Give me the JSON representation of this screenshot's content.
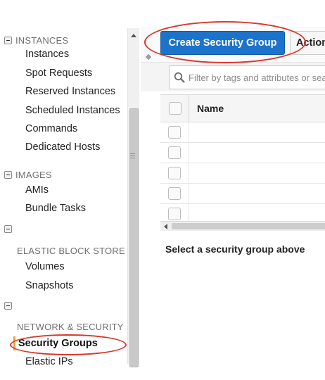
{
  "sidebar": {
    "sections": [
      {
        "label": "INSTANCES",
        "items": [
          "Instances",
          "Spot Requests",
          "Reserved Instances",
          "Scheduled Instances",
          "Commands",
          "Dedicated Hosts"
        ]
      },
      {
        "label": "IMAGES",
        "items": [
          "AMIs",
          "Bundle Tasks"
        ]
      },
      {
        "label": "ELASTIC BLOCK STORE",
        "items": [
          "Volumes",
          "Snapshots"
        ]
      },
      {
        "label": "NETWORK & SECURITY",
        "items": [
          "Security Groups",
          "Elastic IPs"
        ]
      }
    ],
    "active_item": "Security Groups"
  },
  "toolbar": {
    "create_label": "Create Security Group",
    "actions_label": "Actions"
  },
  "filter": {
    "placeholder": "Filter by tags and attributes or search by keyword"
  },
  "table": {
    "columns": [
      "Name"
    ],
    "row_count": 5
  },
  "detail": {
    "message": "Select a security group above"
  },
  "colors": {
    "primary_button": "#1c73cc",
    "annotation": "#d9362d",
    "active_marker": "#e8a43a"
  },
  "icons": [
    "collapse-icon",
    "search-icon",
    "scroll-up-arrow-icon",
    "scroll-left-arrow-icon",
    "scroll-grip-icon"
  ]
}
